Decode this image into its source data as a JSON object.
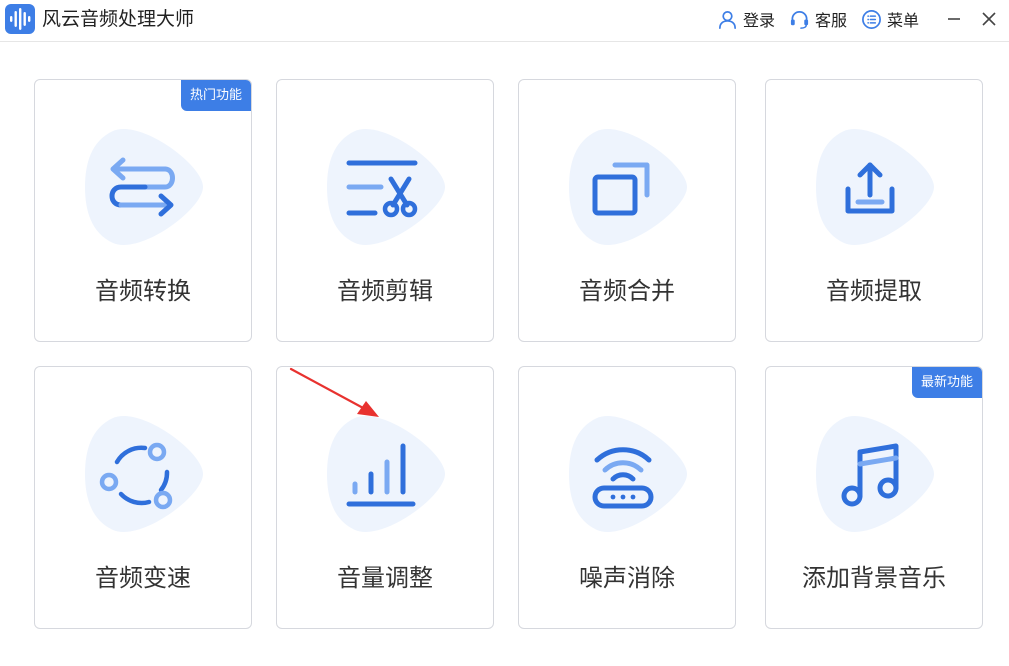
{
  "app": {
    "title": "风云音频处理大师"
  },
  "header": {
    "login_label": "登录",
    "service_label": "客服",
    "menu_label": "菜单"
  },
  "colors": {
    "accent": "#3d7ee6",
    "icon_dark": "#2f6fdb",
    "icon_light": "#7aa9f2",
    "blob": "#eef4fd",
    "arrow": "#e8322f"
  },
  "cards": [
    {
      "label": "音频转换",
      "badge": "热门功能",
      "icon": "convert-icon"
    },
    {
      "label": "音频剪辑",
      "badge": "",
      "icon": "scissors-cut-icon"
    },
    {
      "label": "音频合并",
      "badge": "",
      "icon": "merge-squares-icon"
    },
    {
      "label": "音频提取",
      "badge": "",
      "icon": "upload-tray-icon"
    },
    {
      "label": "音频变速",
      "badge": "",
      "icon": "circle-dots-icon"
    },
    {
      "label": "音量调整",
      "badge": "",
      "icon": "volume-bars-icon"
    },
    {
      "label": "噪声消除",
      "badge": "",
      "icon": "wifi-router-icon"
    },
    {
      "label": "添加背景音乐",
      "badge": "最新功能",
      "icon": "music-note-icon"
    }
  ]
}
